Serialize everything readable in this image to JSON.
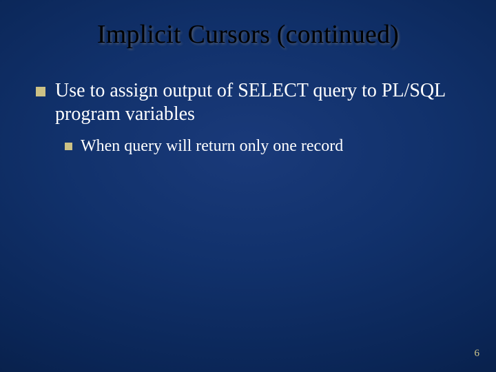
{
  "slide": {
    "title": "Implicit Cursors (continued)",
    "bullets": {
      "level1": {
        "text": "Use to assign output of SELECT query to PL/SQL program variables"
      },
      "level2": {
        "text": "When query will return only one record"
      }
    },
    "page_number": "6"
  }
}
